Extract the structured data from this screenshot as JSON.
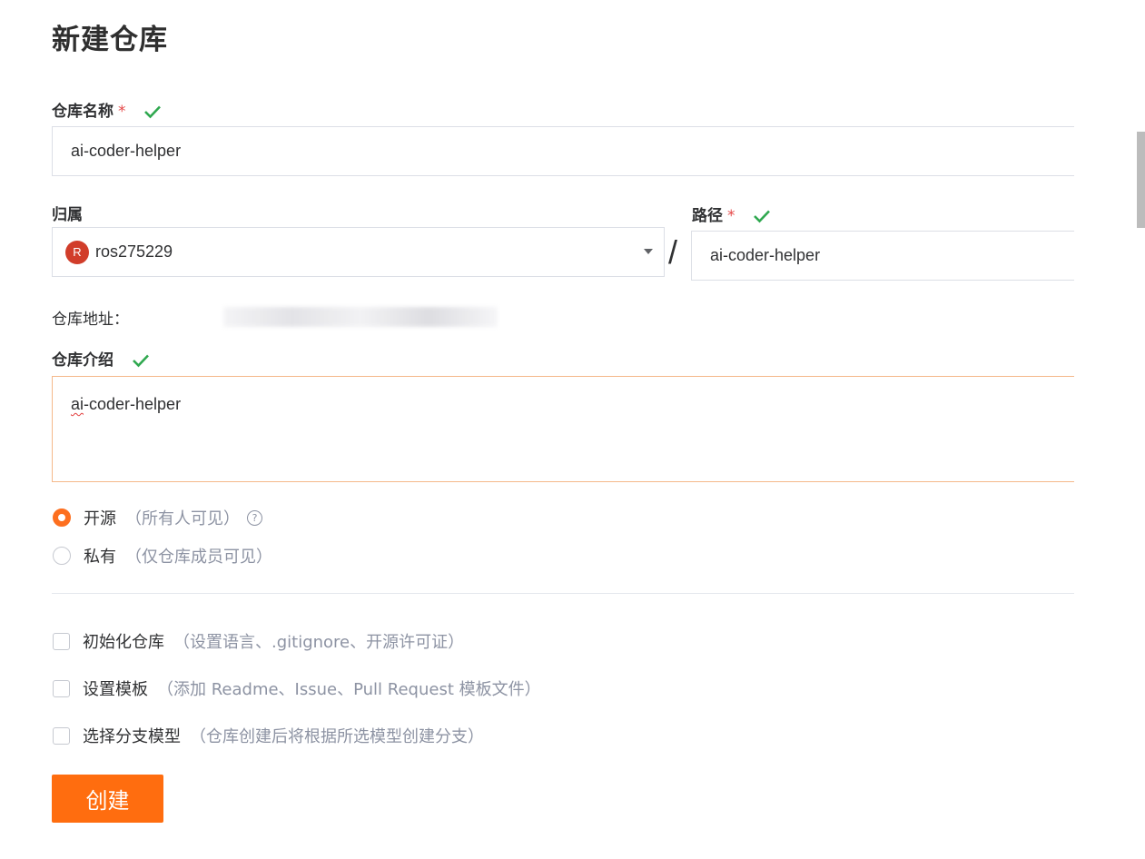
{
  "page_title": "新建仓库",
  "repo_name": {
    "label": "仓库名称",
    "required_mark": "*",
    "value": "ai-coder-helper"
  },
  "owner": {
    "label": "归属",
    "avatar_letter": "R",
    "value": "ros275229"
  },
  "separator": "/",
  "path": {
    "label": "路径",
    "required_mark": "*",
    "value": "ai-coder-helper"
  },
  "repo_address": {
    "label": "仓库地址：",
    "value_visible": "https://git"
  },
  "description": {
    "label": "仓库介绍",
    "value_first": "ai",
    "value_rest": "-coder-helper"
  },
  "visibility": {
    "options": [
      {
        "label": "开源",
        "hint": "（所有人可见）",
        "selected": true
      },
      {
        "label": "私有",
        "hint": "（仅仓库成员可见）",
        "selected": false
      }
    ],
    "help_icon_glyph": "?"
  },
  "extras": [
    {
      "label": "初始化仓库",
      "hint": "（设置语言、.gitignore、开源许可证）",
      "checked": false
    },
    {
      "label": "设置模板",
      "hint": "（添加 Readme、Issue、Pull Request 模板文件）",
      "checked": false
    },
    {
      "label": "选择分支模型",
      "hint": "（仓库创建后将根据所选模型创建分支）",
      "checked": false
    }
  ],
  "create_button": "创建",
  "colors": {
    "accent": "#fd6f1f",
    "button": "#ff6d0f",
    "check": "#2fa84f",
    "required": "#e54848"
  }
}
